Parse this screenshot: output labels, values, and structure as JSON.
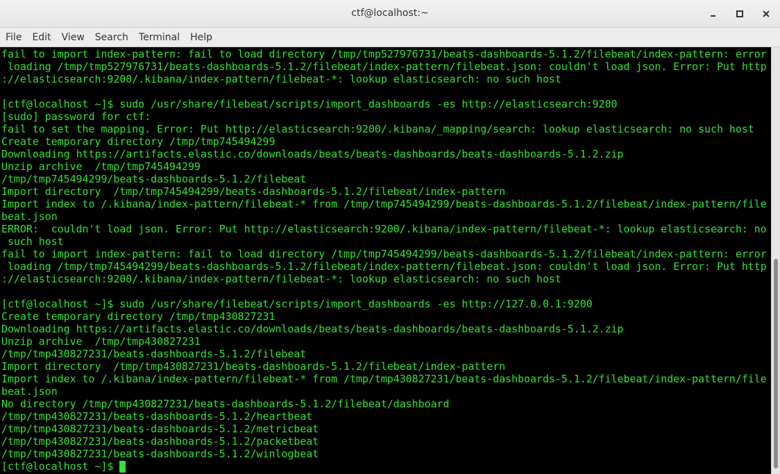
{
  "window": {
    "title": "ctf@localhost:~"
  },
  "menu": {
    "items": [
      "File",
      "Edit",
      "View",
      "Search",
      "Terminal",
      "Help"
    ]
  },
  "terminal": {
    "lines": [
      "fail to import index-pattern: fail to load directory /tmp/tmp527976731/beats-dashboards-5.1.2/filebeat/index-pattern: error",
      " loading /tmp/tmp527976731/beats-dashboards-5.1.2/filebeat/index-pattern/filebeat.json: couldn't load json. Error: Put http",
      "://elasticsearch:9200/.kibana/index-pattern/filebeat-*: lookup elasticsearch: no such host",
      "",
      "[ctf@localhost ~]$ sudo /usr/share/filebeat/scripts/import_dashboards -es http://elasticsearch:9200",
      "[sudo] password for ctf:",
      "fail to set the mapping. Error: Put http://elasticsearch:9200/.kibana/_mapping/search: lookup elasticsearch: no such host",
      "Create temporary directory /tmp/tmp745494299",
      "Downloading https://artifacts.elastic.co/downloads/beats/beats-dashboards/beats-dashboards-5.1.2.zip",
      "Unzip archive  /tmp/tmp745494299",
      "/tmp/tmp745494299/beats-dashboards-5.1.2/filebeat",
      "Import directory  /tmp/tmp745494299/beats-dashboards-5.1.2/filebeat/index-pattern",
      "Import index to /.kibana/index-pattern/filebeat-* from /tmp/tmp745494299/beats-dashboards-5.1.2/filebeat/index-pattern/file",
      "beat.json",
      "ERROR:  couldn't load json. Error: Put http://elasticsearch:9200/.kibana/index-pattern/filebeat-*: lookup elasticsearch: no",
      " such host",
      "fail to import index-pattern: fail to load directory /tmp/tmp745494299/beats-dashboards-5.1.2/filebeat/index-pattern: error",
      " loading /tmp/tmp745494299/beats-dashboards-5.1.2/filebeat/index-pattern/filebeat.json: couldn't load json. Error: Put http",
      "://elasticsearch:9200/.kibana/index-pattern/filebeat-*: lookup elasticsearch: no such host",
      "",
      "[ctf@localhost ~]$ sudo /usr/share/filebeat/scripts/import_dashboards -es http://127.0.0.1:9200",
      "Create temporary directory /tmp/tmp430827231",
      "Downloading https://artifacts.elastic.co/downloads/beats/beats-dashboards/beats-dashboards-5.1.2.zip",
      "Unzip archive  /tmp/tmp430827231",
      "/tmp/tmp430827231/beats-dashboards-5.1.2/filebeat",
      "Import directory  /tmp/tmp430827231/beats-dashboards-5.1.2/filebeat/index-pattern",
      "Import index to /.kibana/index-pattern/filebeat-* from /tmp/tmp430827231/beats-dashboards-5.1.2/filebeat/index-pattern/file",
      "beat.json",
      "No directory /tmp/tmp430827231/beats-dashboards-5.1.2/filebeat/dashboard",
      "/tmp/tmp430827231/beats-dashboards-5.1.2/heartbeat",
      "/tmp/tmp430827231/beats-dashboards-5.1.2/metricbeat",
      "/tmp/tmp430827231/beats-dashboards-5.1.2/packetbeat",
      "/tmp/tmp430827231/beats-dashboards-5.1.2/winlogbeat"
    ],
    "prompt": "[ctf@localhost ~]$",
    "text_color": "#33e233",
    "background_color": "#000000"
  },
  "icons": {
    "minimize": "minimize-icon",
    "maximize": "maximize-icon",
    "close": "close-icon"
  }
}
